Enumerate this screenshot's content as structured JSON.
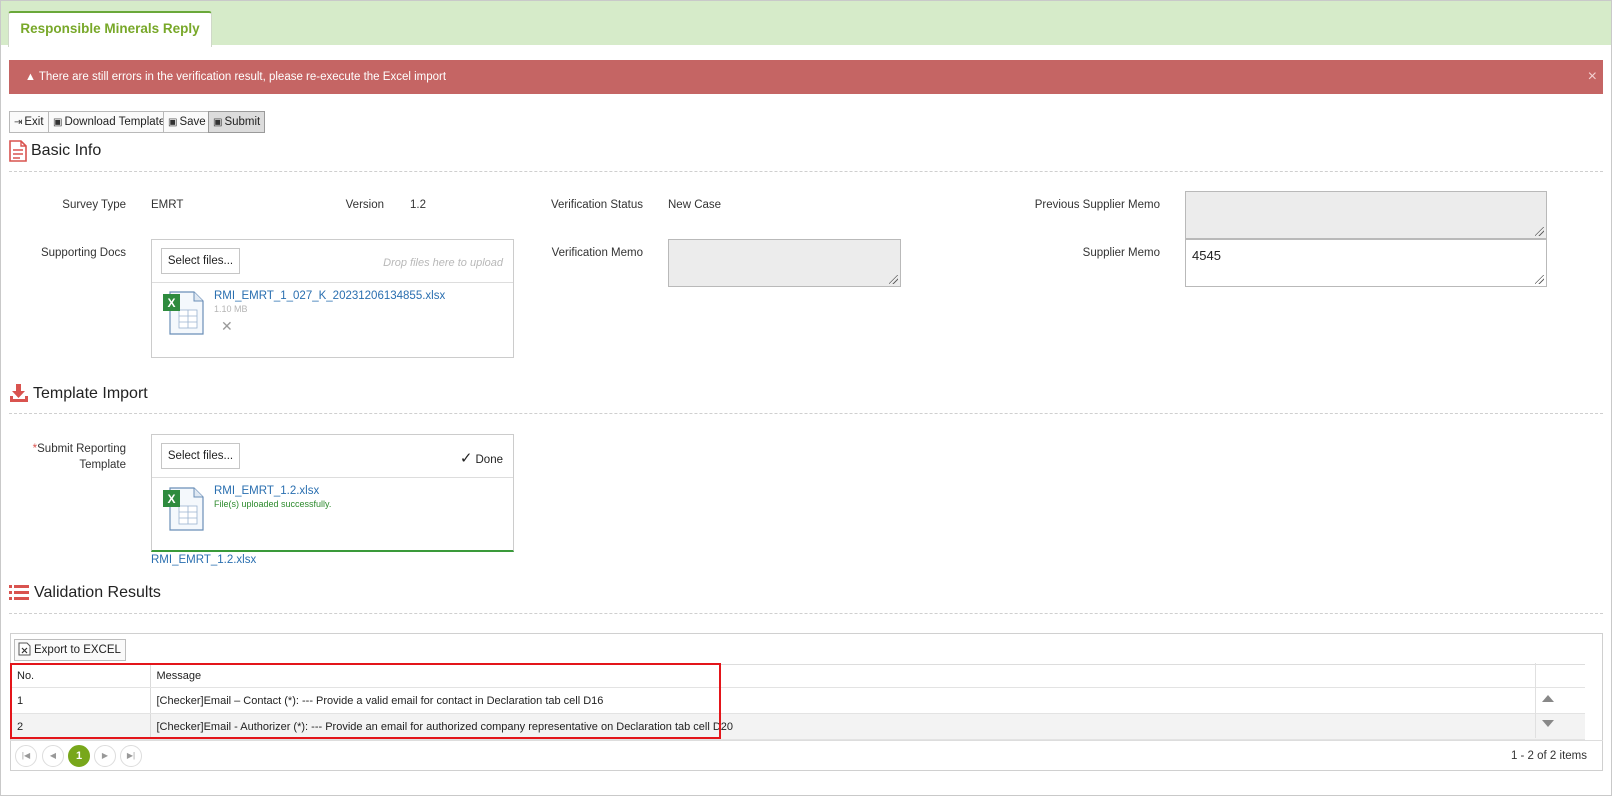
{
  "tab": {
    "label": "Responsible Minerals Reply"
  },
  "alert": {
    "message": "There are still errors in the verification result, please re-execute the Excel import",
    "close": "×"
  },
  "toolbar": {
    "exit": "Exit",
    "download_template": "Download Template",
    "save": "Save",
    "submit": "Submit"
  },
  "basic_info": {
    "title": "Basic Info",
    "survey_type_label": "Survey Type",
    "survey_type_value": "EMRT",
    "version_label": "Version",
    "version_value": "1.2",
    "verification_status_label": "Verification Status",
    "verification_status_value": "New Case",
    "previous_supplier_memo_label": "Previous Supplier Memo",
    "previous_supplier_memo_value": "",
    "supporting_docs_label": "Supporting Docs",
    "verification_memo_label": "Verification Memo",
    "verification_memo_value": "",
    "supplier_memo_label": "Supplier Memo",
    "supplier_memo_value": "4545",
    "upload": {
      "select_label": "Select files...",
      "drop_hint": "Drop files here to upload",
      "file_name": "RMI_EMRT_1_027_K_20231206134855.xlsx",
      "file_size": "1.10 MB",
      "remove": "✕"
    }
  },
  "template_import": {
    "title": "Template Import",
    "required_mark": "*",
    "submit_label": "Submit Reporting Template",
    "upload": {
      "select_label": "Select files...",
      "done_label": "Done",
      "file_name": "RMI_EMRT_1.2.xlsx",
      "status": "File(s) uploaded successfully."
    },
    "uploaded_link": "RMI_EMRT_1.2.xlsx"
  },
  "validation": {
    "title": "Validation Results",
    "export_label": "Export to EXCEL",
    "columns": [
      "No.",
      "Message"
    ],
    "rows": [
      {
        "no": "1",
        "message": "[Checker]Email – Contact (*): --- Provide a valid email for contact in Declaration tab cell D16"
      },
      {
        "no": "2",
        "message": "[Checker]Email - Authorizer (*): --- Provide an email for authorized company representative on Declaration tab cell D20"
      }
    ],
    "pager": {
      "current_page": "1",
      "info": "1 - 2 of 2 items"
    }
  },
  "colors": {
    "tab_bar": "#d6ebc9",
    "alert": "#c56564",
    "accent": "#78a71b",
    "highlight_box": "#e3151a"
  }
}
